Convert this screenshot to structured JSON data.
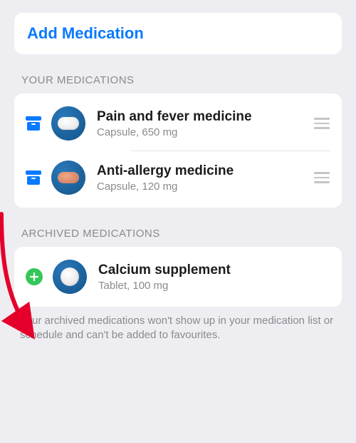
{
  "addMedication": {
    "title": "Add Medication"
  },
  "sections": {
    "your": {
      "header": "YOUR MEDICATIONS"
    },
    "archived": {
      "header": "ARCHIVED MEDICATIONS"
    }
  },
  "medications": [
    {
      "name": "Pain and fever medicine",
      "desc": "Capsule, 650 mg"
    },
    {
      "name": "Anti-allergy medicine",
      "desc": "Capsule, 120 mg"
    }
  ],
  "archived": [
    {
      "name": "Calcium supplement",
      "desc": "Tablet, 100 mg"
    }
  ],
  "footerNote": "Your archived medications won't show up in your medication list or schedule and can't be added to favourites."
}
